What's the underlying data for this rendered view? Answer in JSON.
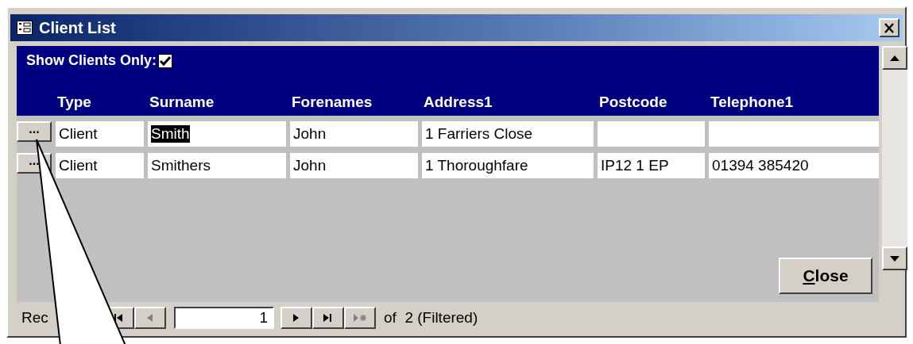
{
  "window": {
    "title": "Client List"
  },
  "filter": {
    "label": "Show Clients Only:",
    "checked": true
  },
  "columns": [
    "Type",
    "Surname",
    "Forenames",
    "Address1",
    "Postcode",
    "Telephone1"
  ],
  "rows": [
    {
      "button": "...",
      "cells": [
        {
          "text": "Client",
          "highlighted": false
        },
        {
          "text": "Smith",
          "highlighted": true
        },
        {
          "text": "John",
          "highlighted": false
        },
        {
          "text": "1 Farriers Close",
          "highlighted": false
        },
        {},
        {}
      ]
    },
    {
      "button": "...",
      "cells": [
        {
          "text": "Client",
          "highlighted": false
        },
        {
          "text": "Smithers",
          "highlighted": false
        },
        {
          "text": "John",
          "highlighted": false
        },
        {
          "text": "1 Thoroughfare",
          "highlighted": false
        },
        {
          "text": "IP12 1 EP",
          "highlighted": false
        },
        {
          "text": "01394 385420",
          "highlighted": false
        }
      ]
    }
  ],
  "close_button": "Close",
  "navigator": {
    "label": "Rec",
    "current": "1",
    "summary": "of  2 (Filtered)",
    "buttons": [
      {
        "kind": "first",
        "disabled": false
      },
      {
        "kind": "prev",
        "disabled": true
      },
      {
        "kind": "next",
        "disabled": false
      },
      {
        "kind": "last",
        "disabled": false
      },
      {
        "kind": "new",
        "disabled": true
      }
    ]
  }
}
